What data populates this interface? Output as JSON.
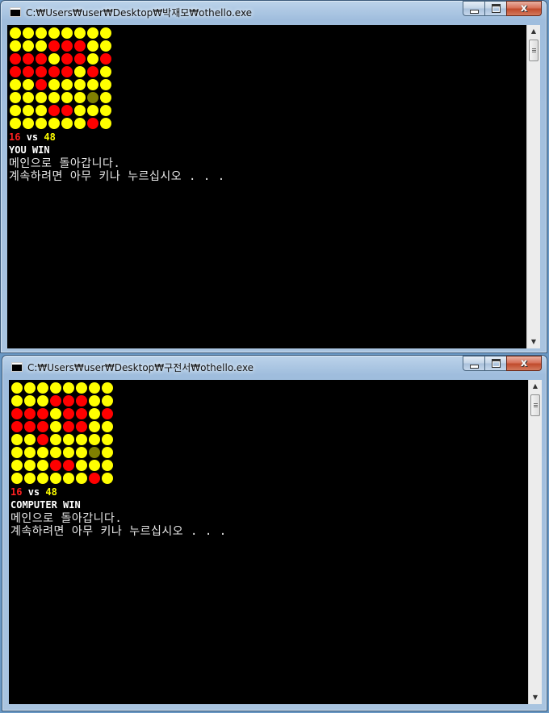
{
  "windows": [
    {
      "title": "C:₩Users₩user₩Desktop₩박재모₩othello.exe",
      "buttons": {
        "minimize_icon": "minimize-icon",
        "maximize_icon": "maximize-icon",
        "close_label": "x"
      },
      "board": [
        "yyyyyyyy",
        "yyyrrryy",
        "rrryrryr",
        "rrrrryry",
        "yyryyyyy",
        "yyyyyyoy",
        "yyyrryyy",
        "yyyyyyry"
      ],
      "score": {
        "red": "16",
        "vs": "vs",
        "yellow": "48"
      },
      "result": "YOU WIN",
      "messages": [
        "메인으로 돌아갑니다.",
        "계속하려면 아무 키나 누르십시오 . . ."
      ]
    },
    {
      "title": "C:₩Users₩user₩Desktop₩구전서₩othello.exe",
      "buttons": {
        "minimize_icon": "minimize-icon",
        "maximize_icon": "maximize-icon",
        "close_label": "x"
      },
      "board": [
        "yyyyyyyy",
        "yyyrrryy",
        "rrryrryr",
        "rrryrryy",
        "yyryyyyy",
        "yyyyyyoy",
        "yyyrryyy",
        "yyyyyyry"
      ],
      "score": {
        "red": "16",
        "vs": "vs",
        "yellow": "48"
      },
      "result": "COMPUTER WIN",
      "messages": [
        "메인으로 돌아갑니다.",
        "계속하려면 아무 키나 누르십시오 . . ."
      ]
    }
  ],
  "colors": {
    "red_disc": "#ff0000",
    "yellow_disc": "#ffff00",
    "hint_disc": "#808000",
    "console_bg": "#000000"
  }
}
